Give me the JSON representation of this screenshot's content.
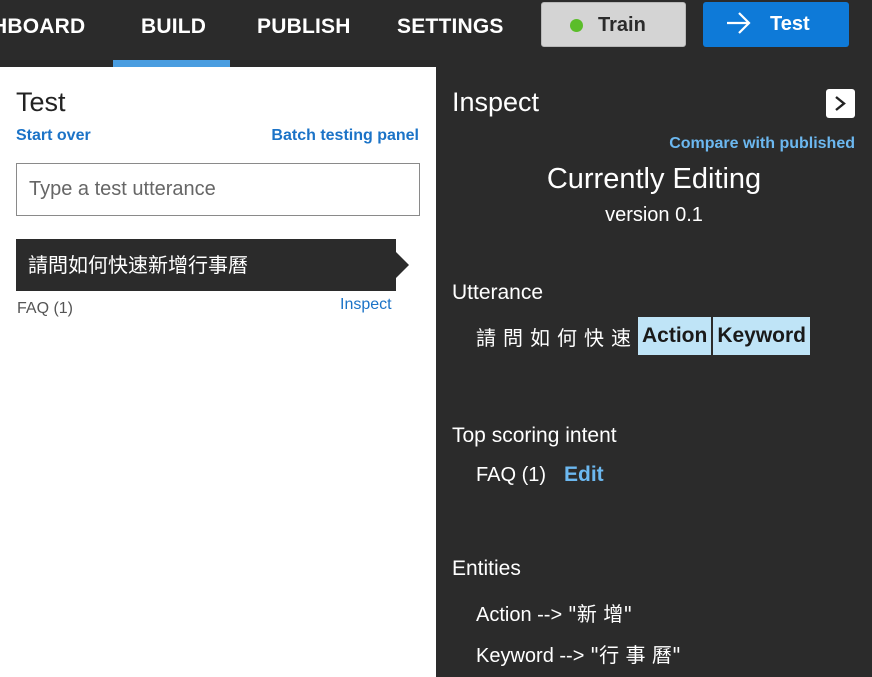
{
  "nav": {
    "items": [
      "HBOARD",
      "BUILD",
      "PUBLISH",
      "SETTINGS"
    ],
    "active": "BUILD",
    "train_label": "Train",
    "test_label": "Test"
  },
  "colors": {
    "accent": "#0e7ad8",
    "link": "#1b73c7",
    "link_dark_bg": "#6cb8f0",
    "entity_highlight": "#bfe4f7",
    "train_status": "#5bbd2a",
    "dark_bg": "#2b2b2b"
  },
  "test_panel": {
    "title": "Test",
    "start_over": "Start over",
    "batch_link": "Batch testing panel",
    "input_placeholder": "Type a test utterance",
    "utterance": {
      "text": "請問如何快速新增行事曆",
      "intent": "FAQ (1)",
      "inspect": "Inspect"
    }
  },
  "inspect_panel": {
    "title": "Inspect",
    "collapse_icon": "chevron-right-icon",
    "compare_link": "Compare with published",
    "editing_title": "Currently Editing",
    "version": "version 0.1",
    "utterance_label": "Utterance",
    "tokens": [
      "請",
      "問",
      "如",
      "何",
      "快",
      "速"
    ],
    "entity_tags": [
      "Action",
      "Keyword"
    ],
    "intent_label": "Top scoring intent",
    "intent_value": "FAQ (1)",
    "edit_label": "Edit",
    "entities_label": "Entities",
    "entities": [
      {
        "name": "Action -->",
        "value": "\"新 增\""
      },
      {
        "name": "Keyword -->",
        "value": "\"行 事 曆\""
      }
    ]
  }
}
